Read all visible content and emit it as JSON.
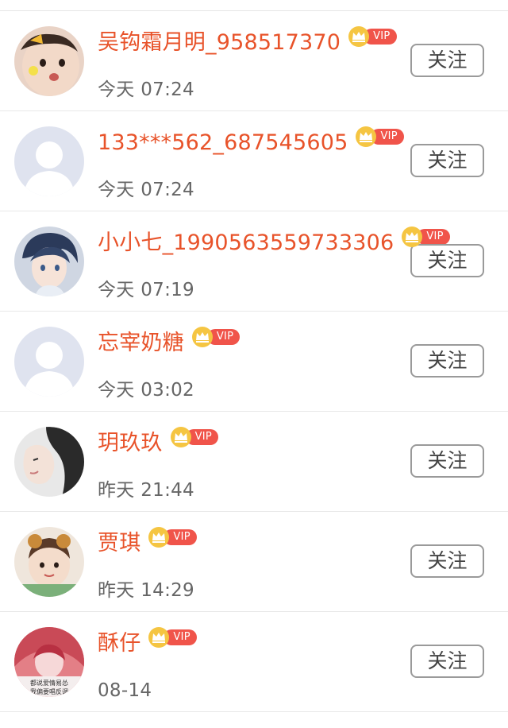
{
  "follow_label": "关注",
  "vip_label": "VIP",
  "colors": {
    "name": "#e8532a",
    "vip_pill": "#f0544a",
    "crown": "#f5c542",
    "time": "#666666",
    "button_border": "#9a9a9a"
  },
  "users": [
    {
      "name": "吴钩霜月明_958517370",
      "time": "今天 07:24",
      "avatar": "baby-photo"
    },
    {
      "name": "133***562_687545605",
      "time": "今天 07:24",
      "avatar": "default-silhouette"
    },
    {
      "name": "小小七_1990563559733306",
      "time": "今天 07:19",
      "avatar": "anime-boy"
    },
    {
      "name": "忘宰奶糖",
      "time": "今天 03:02",
      "avatar": "default-silhouette"
    },
    {
      "name": "玥玖玖",
      "time": "昨天 21:44",
      "avatar": "woman-profile"
    },
    {
      "name": "贾琪",
      "time": "昨天 14:29",
      "avatar": "child-photo"
    },
    {
      "name": "酥仔",
      "time": "08-14",
      "avatar": "anime-girl",
      "avatar_caption": [
        "都说爱情易怂",
        "我偏要唱反调"
      ]
    }
  ]
}
